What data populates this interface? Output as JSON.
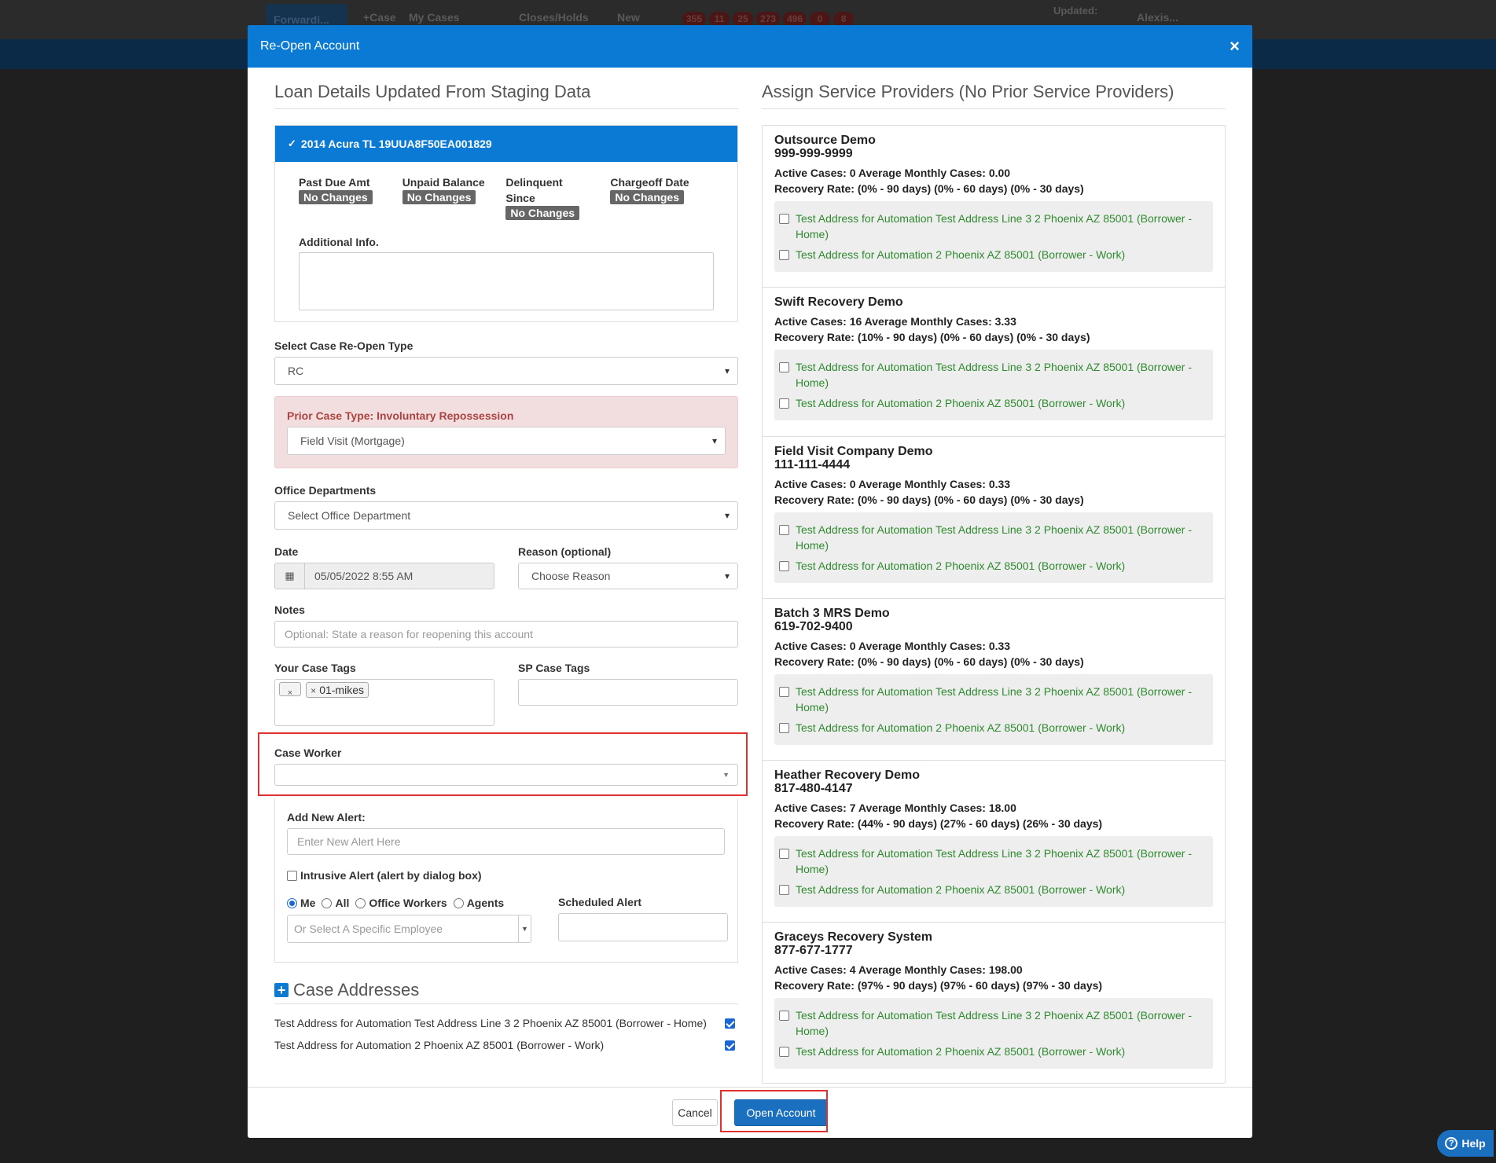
{
  "background": {
    "forward_label": "Forwardi...",
    "nav_items": [
      "+Case",
      "My Cases",
      "Closes/Holds",
      "New"
    ],
    "badges": [
      "355",
      "11",
      "25",
      "273",
      "496",
      "0",
      "8"
    ],
    "updated_label": "Updated:",
    "user_label": "Alexis..."
  },
  "modal": {
    "title": "Re-Open Account",
    "close_label": "×"
  },
  "loan": {
    "section_title": "Loan Details Updated From Staging Data",
    "panel_title": "2014 Acura TL 19UUA8F50EA001829",
    "fields": [
      {
        "label": "Past Due Amt",
        "value": "No Changes"
      },
      {
        "label": "Unpaid Balance",
        "value": "No Changes"
      },
      {
        "label": "Delinquent Since",
        "value": "No Changes"
      },
      {
        "label": "Chargeoff Date",
        "value": "No Changes"
      }
    ],
    "additional_info_label": "Additional Info.",
    "additional_info_value": ""
  },
  "form": {
    "reopen_type_label": "Select Case Re-Open Type",
    "reopen_type_value": "RC",
    "prior_case_type": "Prior Case Type: Involuntary Repossession",
    "prior_case_value": "Field Visit (Mortgage)",
    "office_departments_label": "Office Departments",
    "office_departments_value": "Select Office Department",
    "date_label": "Date",
    "date_value": "05/05/2022 8:55 AM",
    "reason_label": "Reason (optional)",
    "reason_value": "Choose Reason",
    "notes_label": "Notes",
    "notes_placeholder": "Optional: State a reason for reopening this account",
    "your_tags_label": "Your Case Tags",
    "your_tags": [
      "01-mikes"
    ],
    "sp_tags_label": "SP Case Tags",
    "case_worker_label": "Case Worker",
    "case_worker_value": "",
    "add_alert_label": "Add New Alert:",
    "add_alert_placeholder": "Enter New Alert Here",
    "intrusive_alert_label": "Intrusive Alert (alert by dialog box)",
    "recipients": [
      {
        "label": "Me",
        "selected": true
      },
      {
        "label": "All",
        "selected": false
      },
      {
        "label": "Office Workers",
        "selected": false
      },
      {
        "label": "Agents",
        "selected": false
      }
    ],
    "employee_placeholder": "Or Select A Specific Employee",
    "scheduled_alert_label": "Scheduled Alert"
  },
  "case_addresses": {
    "title": "Case Addresses",
    "items": [
      {
        "text": "Test Address for Automation Test Address Line 3 2 Phoenix AZ 85001 (Borrower - Home)",
        "checked": true
      },
      {
        "text": "Test Address for Automation 2 Phoenix AZ 85001 (Borrower - Work)",
        "checked": true
      }
    ]
  },
  "providers": {
    "section_title": "Assign Service Providers (No Prior Service Providers)",
    "items": [
      {
        "name": "Outsource Demo",
        "phone": "999-999-9999",
        "stats": "Active Cases: 0 Average Monthly Cases: 0.00",
        "recovery": "Recovery Rate: (0% - 90 days) (0% - 60 days) (0% - 30 days)",
        "addresses": [
          "Test Address for Automation Test Address Line 3 2 Phoenix AZ 85001 (Borrower - Home)",
          "Test Address for Automation 2 Phoenix AZ 85001 (Borrower - Work)"
        ]
      },
      {
        "name": "Swift Recovery Demo",
        "phone": "",
        "stats": "Active Cases: 16 Average Monthly Cases: 3.33",
        "recovery": "Recovery Rate: (10% - 90 days) (0% - 60 days) (0% - 30 days)",
        "addresses": [
          "Test Address for Automation Test Address Line 3 2 Phoenix AZ 85001 (Borrower - Home)",
          "Test Address for Automation 2 Phoenix AZ 85001 (Borrower - Work)"
        ]
      },
      {
        "name": "Field Visit Company Demo",
        "phone": "111-111-4444",
        "stats": "Active Cases: 0 Average Monthly Cases: 0.33",
        "recovery": "Recovery Rate: (0% - 90 days) (0% - 60 days) (0% - 30 days)",
        "addresses": [
          "Test Address for Automation Test Address Line 3 2 Phoenix AZ 85001 (Borrower - Home)",
          "Test Address for Automation 2 Phoenix AZ 85001 (Borrower - Work)"
        ]
      },
      {
        "name": "Batch 3 MRS Demo",
        "phone": "619-702-9400",
        "stats": "Active Cases: 0 Average Monthly Cases: 0.33",
        "recovery": "Recovery Rate: (0% - 90 days) (0% - 60 days) (0% - 30 days)",
        "addresses": [
          "Test Address for Automation Test Address Line 3 2 Phoenix AZ 85001 (Borrower - Home)",
          "Test Address for Automation 2 Phoenix AZ 85001 (Borrower - Work)"
        ]
      },
      {
        "name": "Heather Recovery Demo",
        "phone": "817-480-4147",
        "stats": "Active Cases: 7 Average Monthly Cases: 18.00",
        "recovery": "Recovery Rate: (44% - 90 days) (27% - 60 days) (26% - 30 days)",
        "addresses": [
          "Test Address for Automation Test Address Line 3 2 Phoenix AZ 85001 (Borrower - Home)",
          "Test Address for Automation 2 Phoenix AZ 85001 (Borrower - Work)"
        ]
      },
      {
        "name": "Graceys Recovery System",
        "phone": "877-677-1777",
        "stats": "Active Cases: 4 Average Monthly Cases: 198.00",
        "recovery": "Recovery Rate: (97% - 90 days) (97% - 60 days) (97% - 30 days)",
        "addresses": [
          "Test Address for Automation Test Address Line 3 2 Phoenix AZ 85001 (Borrower - Home)",
          "Test Address for Automation 2 Phoenix AZ 85001 (Borrower - Work)"
        ]
      }
    ]
  },
  "footer": {
    "cancel_label": "Cancel",
    "open_label": "Open Account"
  },
  "help": {
    "label": "Help"
  },
  "colors": {
    "accent": "#0a7ad4",
    "highlight": "#e03131",
    "link_green": "#2f8a2f",
    "danger_text": "#a94442"
  }
}
